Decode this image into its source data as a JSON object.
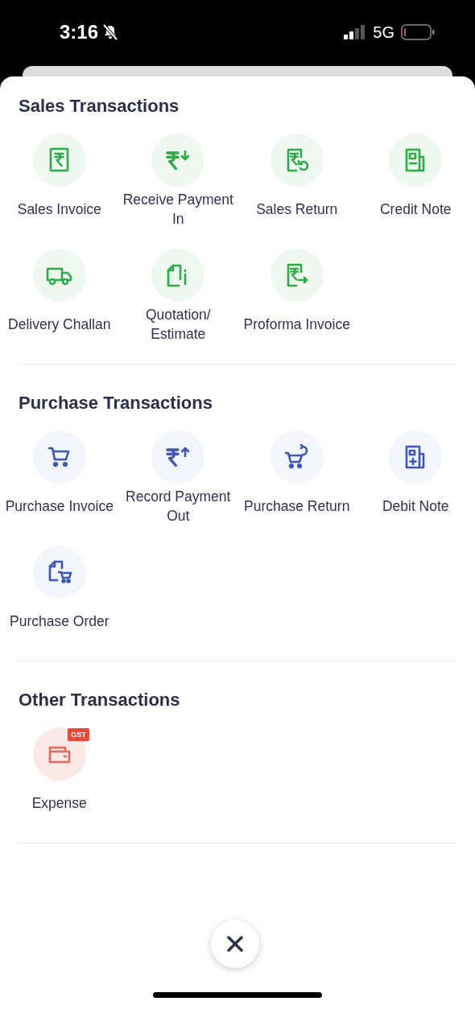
{
  "status_bar": {
    "time": "3:16",
    "network": "5G"
  },
  "sections": [
    {
      "title": "Sales Transactions",
      "kind": "sales",
      "items": [
        {
          "label": "Sales Invoice"
        },
        {
          "label": "Receive Payment In"
        },
        {
          "label": "Sales Return"
        },
        {
          "label": "Credit Note"
        },
        {
          "label": "Delivery Challan"
        },
        {
          "label": "Quotation/ Estimate"
        },
        {
          "label": "Proforma Invoice"
        }
      ]
    },
    {
      "title": "Purchase Transactions",
      "kind": "purchase",
      "items": [
        {
          "label": "Purchase Invoice"
        },
        {
          "label": "Record Payment Out"
        },
        {
          "label": "Purchase Return"
        },
        {
          "label": "Debit Note"
        },
        {
          "label": "Purchase Order"
        }
      ]
    },
    {
      "title": "Other Transactions",
      "kind": "other",
      "items": [
        {
          "label": "Expense",
          "badge": "GST"
        }
      ]
    }
  ]
}
